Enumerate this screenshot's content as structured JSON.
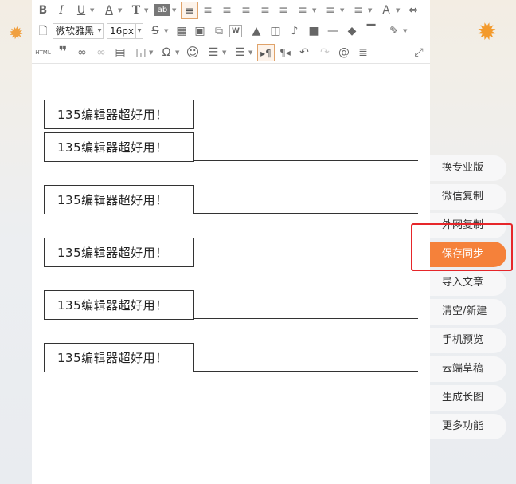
{
  "toolbar": {
    "row1": [
      {
        "name": "bold-button",
        "glyph": "B"
      },
      {
        "name": "italic-button",
        "glyph": "I"
      },
      {
        "name": "underline-button",
        "glyph": "U"
      },
      {
        "name": "font-color-button",
        "glyph": "A"
      },
      {
        "name": "clear-format-button",
        "glyph": "T"
      },
      {
        "name": "background-color-button",
        "glyph": "ab"
      },
      {
        "name": "align-left-button",
        "glyph": "≡"
      },
      {
        "name": "align-center-button",
        "glyph": "≡"
      },
      {
        "name": "align-right-button",
        "glyph": "≡"
      },
      {
        "name": "align-justify-button",
        "glyph": "≡"
      },
      {
        "name": "align-distribute-button",
        "glyph": "≡"
      },
      {
        "name": "indent-button",
        "glyph": "≡"
      },
      {
        "name": "line-height-button",
        "glyph": "≡"
      },
      {
        "name": "paragraph-spacing-button",
        "glyph": "≡"
      },
      {
        "name": "letter-spacing-button",
        "glyph": "≡"
      },
      {
        "name": "text-direction-button",
        "glyph": "A"
      }
    ],
    "font_family": "微软雅黑",
    "font_size": "16px",
    "row3_label_html": "HTML"
  },
  "content": {
    "blocks": [
      {
        "text": "135编辑器超好用！"
      },
      {
        "text": "135编辑器超好用！"
      },
      {
        "text": "135编辑器超好用！"
      },
      {
        "text": "135编辑器超好用！"
      },
      {
        "text": "135编辑器超好用！"
      },
      {
        "text": "135编辑器超好用！"
      }
    ]
  },
  "sidebar": {
    "items": [
      {
        "label": "换专业版"
      },
      {
        "label": "微信复制"
      },
      {
        "label": "外网复制"
      },
      {
        "label": "保存同步",
        "primary": true
      },
      {
        "label": "导入文章"
      },
      {
        "label": "清空/新建"
      },
      {
        "label": "手机预览"
      },
      {
        "label": "云端草稿"
      },
      {
        "label": "生成长图"
      },
      {
        "label": "更多功能"
      }
    ]
  },
  "colors": {
    "accent": "#f5813a",
    "highlight": "#e6262a",
    "active_border": "#e0a36a"
  }
}
